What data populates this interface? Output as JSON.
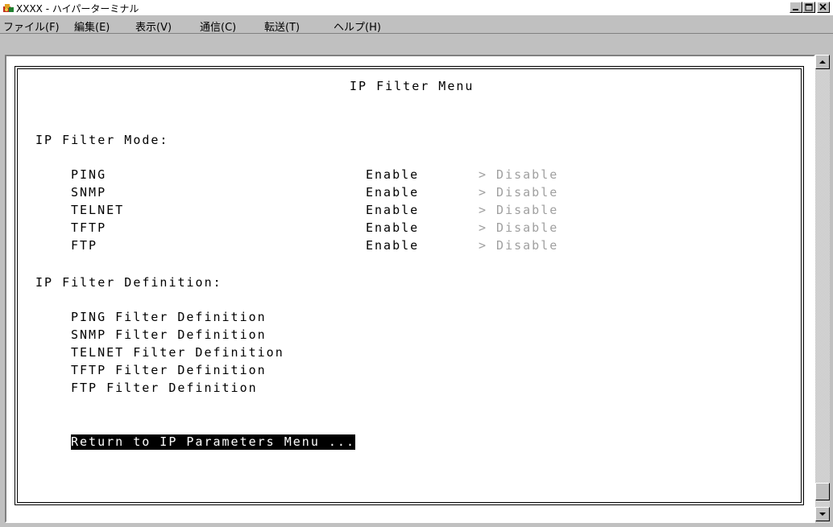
{
  "window": {
    "title": "XXXX - ハイパーターミナル",
    "controls": [
      "minimize",
      "maximize",
      "close"
    ]
  },
  "menu": {
    "items": [
      "ファイル(F)",
      "編集(E)",
      "表示(V)",
      "通信(C)",
      "転送(T)",
      "ヘルプ(H)"
    ]
  },
  "terminal": {
    "heading": "IP Filter Menu",
    "mode_section": "IP Filter Mode:",
    "mode_rows": [
      {
        "name": "PING",
        "enable": "Enable",
        "disable": "> Disable"
      },
      {
        "name": "SNMP",
        "enable": "Enable",
        "disable": "> Disable"
      },
      {
        "name": "TELNET",
        "enable": "Enable",
        "disable": "> Disable"
      },
      {
        "name": "TFTP",
        "enable": "Enable",
        "disable": "> Disable"
      },
      {
        "name": "FTP",
        "enable": "Enable",
        "disable": "> Disable"
      }
    ],
    "definition_section": "IP Filter Definition:",
    "definition_items": [
      "PING Filter Definition",
      "SNMP Filter Definition",
      "TELNET Filter Definition",
      "TFTP Filter Definition",
      "FTP Filter Definition"
    ],
    "return_option": "Return to IP Parameters Menu ..."
  },
  "colors": {
    "selected_bg": "#000000",
    "selected_fg": "#ffffff",
    "disabled_option": "#a0a0a0"
  }
}
